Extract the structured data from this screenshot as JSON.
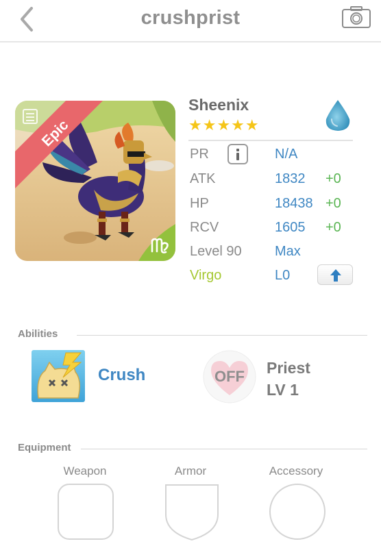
{
  "header": {
    "title": "crushprist",
    "back_icon": "chevron-left-icon",
    "camera_icon": "camera-icon"
  },
  "monster": {
    "name": "Sheenix",
    "rarity_label": "Epic",
    "stars": "★★★★★",
    "star_count": 5,
    "element_icon": "water-drop-icon",
    "zodiac_icon": "virgo-icon",
    "colors": {
      "stat_value": "#3f87c3",
      "stat_bonus": "#5ab553",
      "zodiac": "#a5c832",
      "epic_ribbon": "#e8676b"
    }
  },
  "stats": {
    "pr": {
      "label": "PR",
      "value": "N/A"
    },
    "atk": {
      "label": "ATK",
      "value": "1832",
      "bonus": "+0"
    },
    "hp": {
      "label": "HP",
      "value": "18438",
      "bonus": "+0"
    },
    "rcv": {
      "label": "RCV",
      "value": "1605",
      "bonus": "+0"
    },
    "level": {
      "label": "Level 90",
      "value": "Max"
    },
    "zodiac": {
      "label": "Virgo",
      "value": "L0"
    }
  },
  "abilities": {
    "title": "Abilities",
    "active": {
      "name": "Crush",
      "icon": "crush-ability-icon"
    },
    "passive": {
      "status": "OFF",
      "name": "Priest",
      "level": "LV 1"
    }
  },
  "equipment": {
    "title": "Equipment",
    "slots": [
      {
        "label": "Weapon"
      },
      {
        "label": "Armor"
      },
      {
        "label": "Accessory"
      }
    ]
  }
}
